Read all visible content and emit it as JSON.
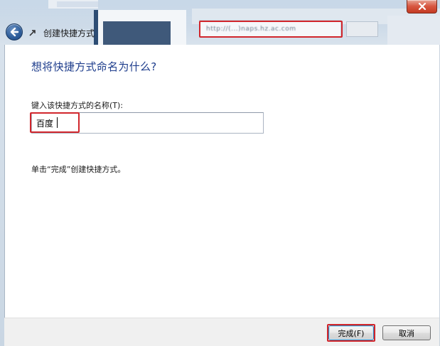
{
  "window": {
    "title": "创建快捷方式",
    "blurred_url": "http://(...)naps.hz.ac.com"
  },
  "wizard": {
    "heading": "想将快捷方式命名为什么?",
    "field_label": "键入该快捷方式的名称(T):",
    "name_value": "百度",
    "instruction": "单击“完成”创建快捷方式。"
  },
  "buttons": {
    "finish": "完成(F)",
    "cancel": "取消"
  },
  "colors": {
    "heading": "#1e3d8c",
    "highlight": "#d1262c",
    "back_button": "#2f5f9c",
    "close_button": "#c43a23"
  },
  "icons": {
    "back": "back-arrow-icon",
    "wizard": "shortcut-wizard-icon",
    "close": "close-icon"
  }
}
